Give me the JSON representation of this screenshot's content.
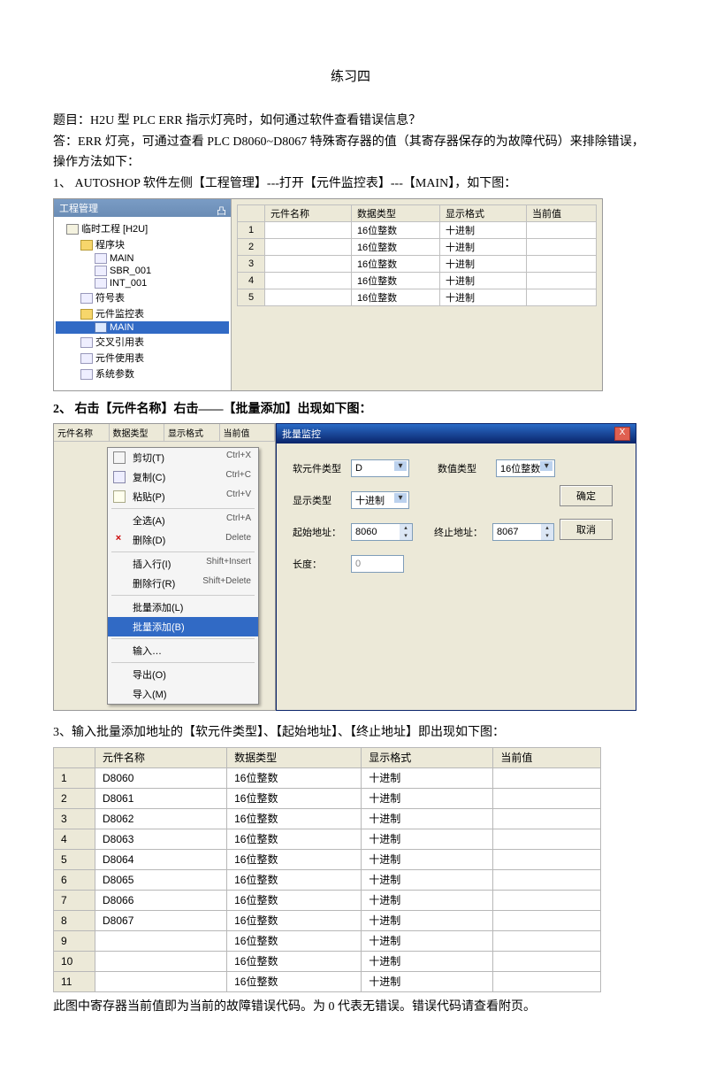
{
  "title": "练习四",
  "question_line": "题目：H2U 型 PLC   ERR 指示灯亮时，如何通过软件查看错误信息？",
  "answer_line": "答：ERR 灯亮，可通过查看 PLC D8060~D8067 特殊寄存器的值（其寄存器保存的为故障代码）来排除错误，操作方法如下：",
  "step1": "1、 AUTOSHOP 软件左侧【工程管理】---打开【元件监控表】---【MAIN】，如下图：",
  "tree": {
    "panel_title": "工程管理",
    "pin_label": "凸 ×",
    "root": "临时工程 [H2U]",
    "nodes": [
      "程序块",
      "MAIN",
      "SBR_001",
      "INT_001",
      "符号表",
      "元件监控表",
      "MAIN",
      "交叉引用表",
      "元件使用表",
      "系统参数"
    ]
  },
  "table1": {
    "headers": [
      "",
      "元件名称",
      "数据类型",
      "显示格式",
      "当前值"
    ],
    "rows": [
      [
        "1",
        "",
        "16位整数",
        "十进制",
        ""
      ],
      [
        "2",
        "",
        "16位整数",
        "十进制",
        ""
      ],
      [
        "3",
        "",
        "16位整数",
        "十进制",
        ""
      ],
      [
        "4",
        "",
        "16位整数",
        "十进制",
        ""
      ],
      [
        "5",
        "",
        "16位整数",
        "十进制",
        ""
      ]
    ]
  },
  "step2": "2、 右击【元件名称】右击——【批量添加】出现如下图：",
  "strip": [
    "元件名称",
    "数据类型",
    "显示格式",
    "当前值"
  ],
  "ctx": {
    "items": [
      {
        "label": "剪切(T)",
        "shortcut": "Ctrl+X",
        "ico": "cut"
      },
      {
        "label": "复制(C)",
        "shortcut": "Ctrl+C",
        "ico": "copy"
      },
      {
        "label": "粘贴(P)",
        "shortcut": "Ctrl+V",
        "ico": "paste"
      },
      {
        "sep": true
      },
      {
        "label": "全选(A)",
        "shortcut": "Ctrl+A"
      },
      {
        "label": "删除(D)",
        "shortcut": "Delete",
        "ico": "del"
      },
      {
        "sep": true
      },
      {
        "label": "插入行(I)",
        "shortcut": "Shift+Insert"
      },
      {
        "label": "删除行(R)",
        "shortcut": "Shift+Delete"
      },
      {
        "sep": true
      },
      {
        "label": "批量添加(L)"
      },
      {
        "label": "批量添加(B)",
        "sel": true
      },
      {
        "sep": true
      },
      {
        "label": "输入…"
      },
      {
        "sep": true
      },
      {
        "label": "导出(O)"
      },
      {
        "label": "导入(M)"
      }
    ]
  },
  "dialog": {
    "title": "批量监控",
    "close": "X",
    "row1_label1": "软元件类型",
    "row1_val1": "D",
    "row1_label2": "数值类型",
    "row1_val2": "16位整数",
    "row2_label": "显示类型",
    "row2_val": "十进制",
    "row3_label1": "起始地址：",
    "row3_val1": "8060",
    "row3_label2": "终止地址：",
    "row3_val2": "8067",
    "row4_label": "长度：",
    "row4_val": "0",
    "btn_ok": "确定",
    "btn_cancel": "取消"
  },
  "step3": "3、输入批量添加地址的【软元件类型】、【起始地址】、【终止地址】即出现如下图：",
  "table3": {
    "headers": [
      "",
      "元件名称",
      "数据类型",
      "显示格式",
      "当前值"
    ],
    "rows": [
      [
        "1",
        "D8060",
        "16位整数",
        "十进制",
        ""
      ],
      [
        "2",
        "D8061",
        "16位整数",
        "十进制",
        ""
      ],
      [
        "3",
        "D8062",
        "16位整数",
        "十进制",
        ""
      ],
      [
        "4",
        "D8063",
        "16位整数",
        "十进制",
        ""
      ],
      [
        "5",
        "D8064",
        "16位整数",
        "十进制",
        ""
      ],
      [
        "6",
        "D8065",
        "16位整数",
        "十进制",
        ""
      ],
      [
        "7",
        "D8066",
        "16位整数",
        "十进制",
        ""
      ],
      [
        "8",
        "D8067",
        "16位整数",
        "十进制",
        ""
      ],
      [
        "9",
        "",
        "16位整数",
        "十进制",
        ""
      ],
      [
        "10",
        "",
        "16位整数",
        "十进制",
        ""
      ],
      [
        "11",
        "",
        "16位整数",
        "十进制",
        ""
      ]
    ]
  },
  "footer": "此图中寄存器当前值即为当前的故障错误代码。为 0 代表无错误。错误代码请查看附页。"
}
